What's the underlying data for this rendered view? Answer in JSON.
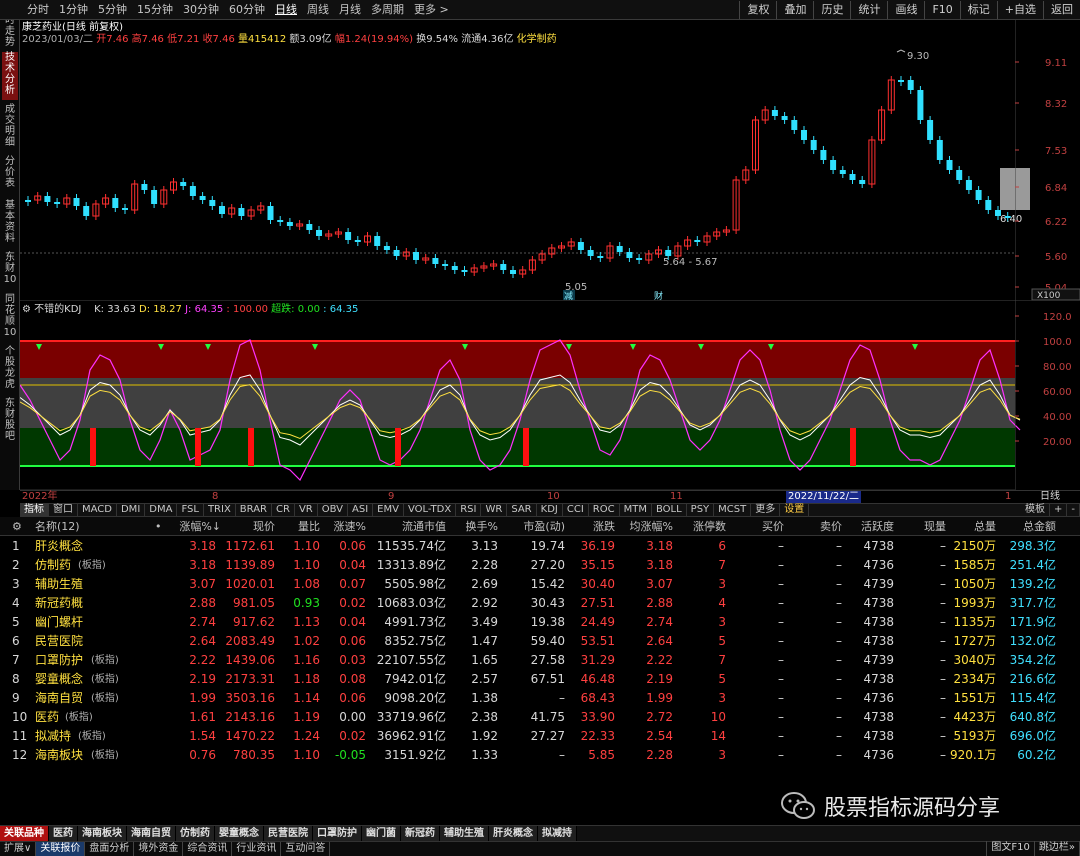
{
  "periods": {
    "items": [
      "分时",
      "1分钟",
      "5分钟",
      "15分钟",
      "30分钟",
      "60分钟",
      "日线",
      "周线",
      "月线",
      "多周期",
      "更多"
    ],
    "active": "日线",
    "more_arrow": ">"
  },
  "toolbar_right": [
    "复权",
    "叠加",
    "历史",
    "统计",
    "画线",
    "F10",
    "标记",
    "+自选",
    "返回"
  ],
  "left_tabs": [
    "分时走势",
    "技术分析",
    "成交明细",
    "分价表",
    "基本资料",
    "东财10",
    "同花顺10",
    "个股龙虎",
    "东财股吧"
  ],
  "left_tab_active": "技术分析",
  "stock": {
    "name": "康芝药业(日线 前复权)",
    "date": "2023/01/03/二",
    "open": "开7.46",
    "high": "高7.46",
    "low": "低7.21",
    "close": "收7.46",
    "volume": "量415412",
    "amount": "额3.09亿",
    "change": "幅1.24(19.94%)",
    "turnover": "换9.54%",
    "float_cap": "流通4.36亿",
    "sector": "化学制药"
  },
  "main_axis": {
    "labels": [
      "9.11",
      "8.32",
      "7.53",
      "6.84",
      "6.22",
      "5.60",
      "5.04"
    ],
    "scale_btn": "X100"
  },
  "annotations": {
    "high": "9.30",
    "range": "5.64 - 5.67",
    "low": "5.05",
    "last": "6.40",
    "tag1": "减",
    "tag2": "财"
  },
  "kdj": {
    "title": "不错的KDJ",
    "k": "K: 33.63",
    "d": "D: 18.27",
    "j": "J: 64.35",
    "extra1": ": 100.00",
    "extra2": "超跌: 0.00",
    "extra3": ": 64.35",
    "axis": [
      "120.0",
      "100.0",
      "80.00",
      "60.00",
      "40.00",
      "20.00"
    ]
  },
  "date_axis": {
    "labels": [
      "2022年",
      "8",
      "9",
      "10",
      "11",
      "1"
    ],
    "highlight": "2022/11/22/二",
    "right_btn": "日线"
  },
  "indicator_tabs": [
    "指标",
    "窗口",
    "MACD",
    "DMI",
    "DMA",
    "FSL",
    "TRIX",
    "BRAR",
    "CR",
    "VR",
    "OBV",
    "ASI",
    "EMV",
    "VOL-TDX",
    "RSI",
    "WR",
    "SAR",
    "KDJ",
    "CCI",
    "ROC",
    "MTM",
    "BOLL",
    "PSY",
    "MCST",
    "更多",
    "设置"
  ],
  "indicator_right": [
    "模板",
    "+",
    "-"
  ],
  "table": {
    "headers": [
      "名称(12)",
      "•",
      "涨幅%↓",
      "现价",
      "量比",
      "涨速%",
      "流通市值",
      "换手%",
      "市盈(动)",
      "涨跌",
      "均涨幅%",
      "涨停数",
      "买价",
      "卖价",
      "活跃度",
      "现量",
      "总量",
      "总金额"
    ],
    "rows": [
      {
        "idx": "1",
        "name": "肝炎概念",
        "tag": "",
        "chg": "3.18",
        "price": "1172.61",
        "vr": "1.10",
        "spd": "0.06",
        "cap": "11535.74亿",
        "turn": "3.13",
        "pe": "19.74",
        "diff": "36.19",
        "avg": "3.18",
        "limit": "6",
        "bid": "–",
        "ask": "–",
        "act": "4738",
        "cur": "–",
        "vol": "2150万",
        "amt": "298.3亿"
      },
      {
        "idx": "2",
        "name": "仿制药",
        "tag": "(板指)",
        "chg": "3.18",
        "price": "1139.89",
        "vr": "1.10",
        "spd": "0.04",
        "cap": "13313.89亿",
        "turn": "2.28",
        "pe": "27.20",
        "diff": "35.15",
        "avg": "3.18",
        "limit": "7",
        "bid": "–",
        "ask": "–",
        "act": "4736",
        "cur": "–",
        "vol": "1585万",
        "amt": "251.4亿"
      },
      {
        "idx": "3",
        "name": "辅助生殖",
        "tag": "",
        "chg": "3.07",
        "price": "1020.01",
        "vr": "1.08",
        "spd": "0.07",
        "cap": "5505.98亿",
        "turn": "2.69",
        "pe": "15.42",
        "diff": "30.40",
        "avg": "3.07",
        "limit": "3",
        "bid": "–",
        "ask": "–",
        "act": "4739",
        "cur": "–",
        "vol": "1050万",
        "amt": "139.2亿"
      },
      {
        "idx": "4",
        "name": "新冠药概",
        "tag": "",
        "chg": "2.88",
        "price": "981.05",
        "vr": "0.93",
        "spd": "0.02",
        "cap": "10683.03亿",
        "turn": "2.92",
        "pe": "30.43",
        "diff": "27.51",
        "avg": "2.88",
        "limit": "4",
        "bid": "–",
        "ask": "–",
        "act": "4738",
        "cur": "–",
        "vol": "1993万",
        "amt": "317.7亿"
      },
      {
        "idx": "5",
        "name": "幽门螺杆",
        "tag": "",
        "chg": "2.74",
        "price": "917.62",
        "vr": "1.13",
        "spd": "0.04",
        "cap": "4991.73亿",
        "turn": "3.49",
        "pe": "19.38",
        "diff": "24.49",
        "avg": "2.74",
        "limit": "3",
        "bid": "–",
        "ask": "–",
        "act": "4738",
        "cur": "–",
        "vol": "1135万",
        "amt": "171.9亿"
      },
      {
        "idx": "6",
        "name": "民营医院",
        "tag": "",
        "chg": "2.64",
        "price": "2083.49",
        "vr": "1.02",
        "spd": "0.06",
        "cap": "8352.75亿",
        "turn": "1.47",
        "pe": "59.40",
        "diff": "53.51",
        "avg": "2.64",
        "limit": "5",
        "bid": "–",
        "ask": "–",
        "act": "4738",
        "cur": "–",
        "vol": "1727万",
        "amt": "132.0亿"
      },
      {
        "idx": "7",
        "name": "口罩防护",
        "tag": "(板指)",
        "chg": "2.22",
        "price": "1439.06",
        "vr": "1.16",
        "spd": "0.03",
        "cap": "22107.55亿",
        "turn": "1.65",
        "pe": "27.58",
        "diff": "31.29",
        "avg": "2.22",
        "limit": "7",
        "bid": "–",
        "ask": "–",
        "act": "4739",
        "cur": "–",
        "vol": "3040万",
        "amt": "354.2亿"
      },
      {
        "idx": "8",
        "name": "婴童概念",
        "tag": "(板指)",
        "chg": "2.19",
        "price": "2173.31",
        "vr": "1.18",
        "spd": "0.08",
        "cap": "7942.01亿",
        "turn": "2.57",
        "pe": "67.51",
        "diff": "46.48",
        "avg": "2.19",
        "limit": "5",
        "bid": "–",
        "ask": "–",
        "act": "4738",
        "cur": "–",
        "vol": "2334万",
        "amt": "216.6亿"
      },
      {
        "idx": "9",
        "name": "海南自贸",
        "tag": "(板指)",
        "chg": "1.99",
        "price": "3503.16",
        "vr": "1.14",
        "spd": "0.06",
        "cap": "9098.20亿",
        "turn": "1.38",
        "pe": "–",
        "diff": "68.43",
        "avg": "1.99",
        "limit": "3",
        "bid": "–",
        "ask": "–",
        "act": "4736",
        "cur": "–",
        "vol": "1551万",
        "amt": "115.4亿"
      },
      {
        "idx": "10",
        "name": "医药",
        "tag": "(板指)",
        "chg": "1.61",
        "price": "2143.16",
        "vr": "1.19",
        "spd": "0.00",
        "cap": "33719.96亿",
        "turn": "2.38",
        "pe": "41.75",
        "diff": "33.90",
        "avg": "2.72",
        "limit": "10",
        "bid": "–",
        "ask": "–",
        "act": "4738",
        "cur": "–",
        "vol": "4423万",
        "amt": "640.8亿"
      },
      {
        "idx": "11",
        "name": "拟减持",
        "tag": "(板指)",
        "chg": "1.54",
        "price": "1470.22",
        "vr": "1.24",
        "spd": "0.02",
        "cap": "36962.91亿",
        "turn": "1.92",
        "pe": "27.27",
        "diff": "22.33",
        "avg": "2.54",
        "limit": "14",
        "bid": "–",
        "ask": "–",
        "act": "4738",
        "cur": "–",
        "vol": "5193万",
        "amt": "696.0亿"
      },
      {
        "idx": "12",
        "name": "海南板块",
        "tag": "(板指)",
        "chg": "0.76",
        "price": "780.35",
        "vr": "1.10",
        "spd": "-0.05",
        "cap": "3151.92亿",
        "turn": "1.33",
        "pe": "–",
        "diff": "5.85",
        "avg": "2.28",
        "limit": "3",
        "bid": "–",
        "ask": "–",
        "act": "4736",
        "cur": "–",
        "vol": "920.1万",
        "amt": "60.2亿"
      }
    ]
  },
  "watermark": "股票指标源码分享",
  "sector_tabs": [
    "关联品种",
    "医药",
    "海南板块",
    "海南自贸",
    "仿制药",
    "婴童概念",
    "民营医院",
    "口罩防护",
    "幽门菌",
    "新冠药",
    "辅助生殖",
    "肝炎概念",
    "拟减持"
  ],
  "status_bar": [
    "扩展∨",
    "关联报价",
    "盘面分析",
    "境外资金",
    "综合资讯",
    "行业资讯",
    "互动问答"
  ],
  "status_right": [
    "图文F10",
    "跳边栏»"
  ],
  "colors": {
    "up": "#ff3030",
    "down": "#30e0ff",
    "k_line": "#ffffff",
    "d_line": "#ffe040",
    "j_line": "#ff30ff",
    "band_top": "#7a0000",
    "band_mid": "#404040",
    "band_bottom": "#003800"
  }
}
